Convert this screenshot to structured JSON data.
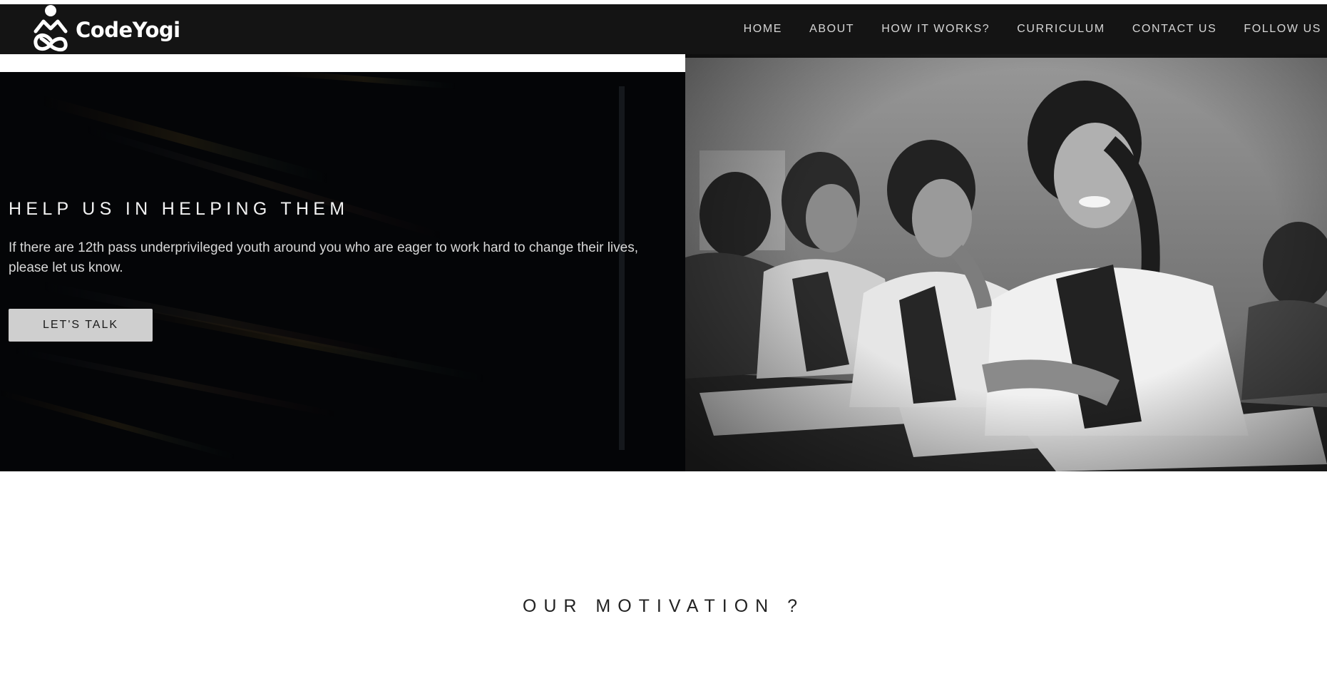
{
  "brand": {
    "name": "CodeYogi",
    "logo_icon": "yogi-logo-icon"
  },
  "nav": {
    "items": [
      {
        "label": "HOME"
      },
      {
        "label": "ABOUT"
      },
      {
        "label": "HOW IT WORKS?"
      },
      {
        "label": "CURRICULUM"
      },
      {
        "label": "CONTACT US"
      },
      {
        "label": "FOLLOW US"
      }
    ]
  },
  "hero": {
    "title": "HELP US IN HELPING THEM",
    "text": "If there are 12th pass underprivileged youth around you who are eager to work hard to change their lives, please let us know.",
    "cta_label": "LET'S TALK",
    "image_icon": "students-photo"
  },
  "motivation": {
    "title": "OUR MOTIVATION ?"
  },
  "colors": {
    "header_bg": "#141414",
    "hero_left_bg": "#040507",
    "button_bg": "#cfcfcf",
    "nav_text": "#d6d6d6"
  }
}
